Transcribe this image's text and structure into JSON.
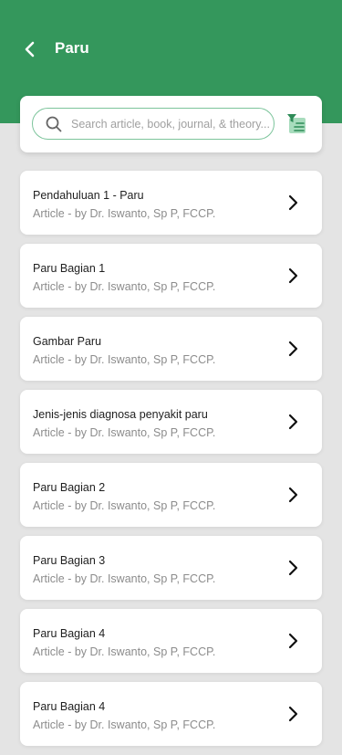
{
  "header": {
    "title": "Paru",
    "back_icon": "chevron-left-icon",
    "background": "#34975c"
  },
  "search": {
    "placeholder": "Search article, book, journal, & theory...",
    "value": "",
    "icon": "search-icon",
    "filter_icon": "filter-icon",
    "border_color": "#7cc49b"
  },
  "articles": [
    {
      "title": "Pendahuluan 1 - Paru",
      "subtitle": "Article - by Dr. Iswanto, Sp P, FCCP."
    },
    {
      "title": "Paru Bagian 1",
      "subtitle": "Article - by Dr. Iswanto, Sp P, FCCP."
    },
    {
      "title": "Gambar Paru",
      "subtitle": "Article - by Dr. Iswanto, Sp P, FCCP."
    },
    {
      "title": "Jenis-jenis diagnosa penyakit paru",
      "subtitle": "Article - by Dr. Iswanto, Sp P, FCCP."
    },
    {
      "title": "Paru Bagian 2",
      "subtitle": "Article - by Dr. Iswanto, Sp P, FCCP."
    },
    {
      "title": "Paru Bagian 3",
      "subtitle": "Article - by Dr. Iswanto, Sp P, FCCP."
    },
    {
      "title": "Paru Bagian 4",
      "subtitle": "Article - by Dr. Iswanto, Sp P, FCCP."
    },
    {
      "title": "Paru Bagian 4",
      "subtitle": "Article - by Dr. Iswanto, Sp P, FCCP."
    }
  ]
}
